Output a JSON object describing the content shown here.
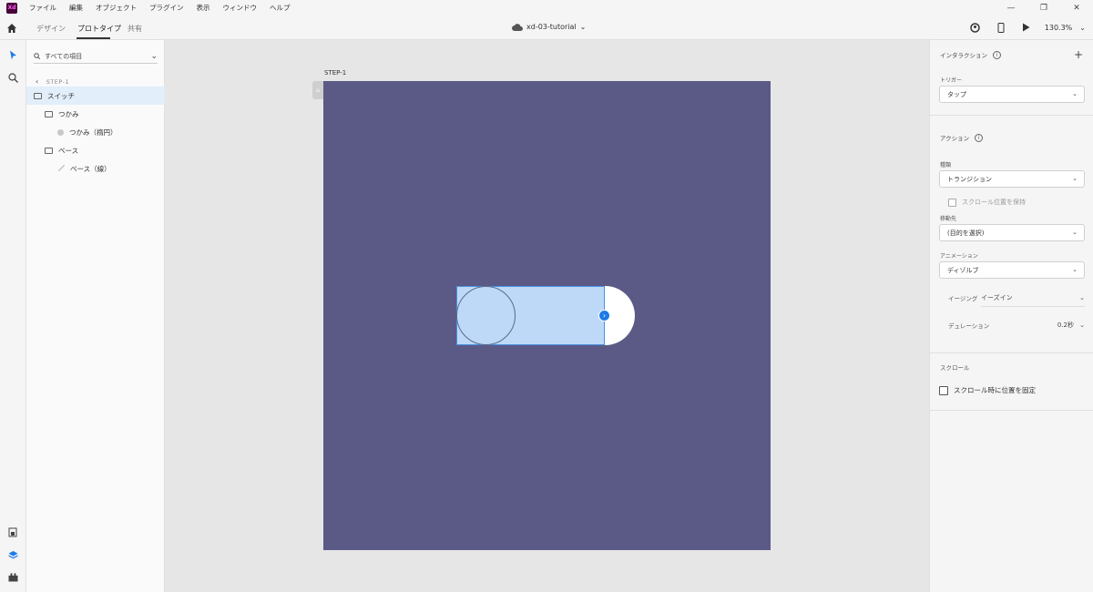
{
  "menu": {
    "logo": "Xd",
    "items": [
      "ファイル",
      "編集",
      "オブジェクト",
      "プラグイン",
      "表示",
      "ウィンドウ",
      "ヘルプ"
    ]
  },
  "window_controls": [
    "—",
    "❐",
    "✕"
  ],
  "tabs": {
    "design": "デザイン",
    "prototype": "プロトタイプ",
    "share": "共有"
  },
  "document": {
    "title": "xd-03-tutorial"
  },
  "toolbar": {
    "zoom": "130.3%"
  },
  "layers": {
    "search_label": "すべての項目",
    "breadcrumb": "STEP-1",
    "items": [
      {
        "label": "スイッチ",
        "type": "folder",
        "selected": true
      },
      {
        "label": "つかみ",
        "type": "folder",
        "selected": false
      },
      {
        "label": "つかみ（楕円）",
        "type": "ellipse",
        "selected": false
      },
      {
        "label": "ベース",
        "type": "folder",
        "selected": false
      },
      {
        "label": "ベース（線）",
        "type": "line",
        "selected": false
      }
    ]
  },
  "canvas": {
    "artboard_name": "STEP-1",
    "artboard_color": "#5b5a87",
    "selection_color": "#bdd9f7",
    "accent_color": "#1e7ae6"
  },
  "props": {
    "interaction_title": "インタラクション",
    "trigger_label": "トリガー",
    "trigger_value": "タップ",
    "action_title": "アクション",
    "type_label": "種類",
    "type_value": "トランジション",
    "keep_scroll_label": "スクロール位置を保持",
    "destination_label": "移動先",
    "destination_value": "(目的を選択)",
    "animation_label": "アニメーション",
    "animation_value": "ディゾルブ",
    "easing_label": "イージング",
    "easing_value": "イーズイン",
    "duration_label": "デュレーション",
    "duration_value": "0.2秒",
    "scroll_title": "スクロール",
    "fix_position_label": "スクロール時に位置を固定"
  }
}
